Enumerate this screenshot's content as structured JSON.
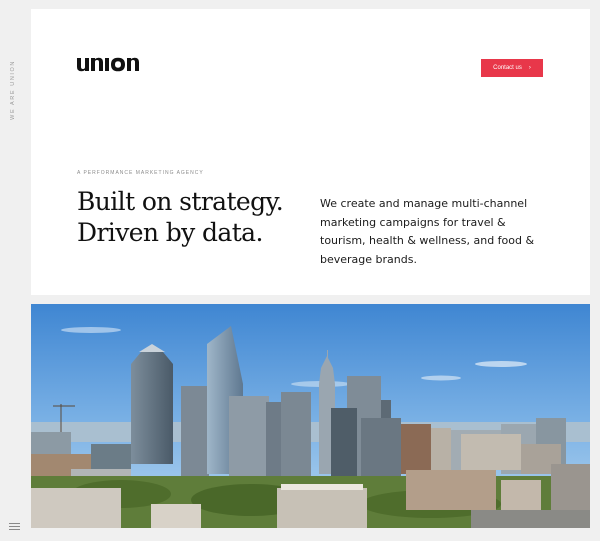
{
  "sidebar": {
    "vertical_tag": "WE ARE UNION",
    "menu_icon": "hamburger-icon"
  },
  "header": {
    "logo_text": "union",
    "contact_button": "Contact us",
    "contact_arrow_icon": "chevron-right-icon"
  },
  "intro": {
    "eyebrow": "A PERFORMANCE MARKETING AGENCY",
    "headline": [
      "Built on strategy.",
      "Driven by data."
    ],
    "description": "We create and manage multi-channel marketing campaigns for travel & tourism, health & wellness, and food & beverage brands."
  },
  "colors": {
    "accent": "#e8374a",
    "panel_bg": "#ffffff",
    "page_bg": "#f0f0f0",
    "text": "#111111"
  }
}
